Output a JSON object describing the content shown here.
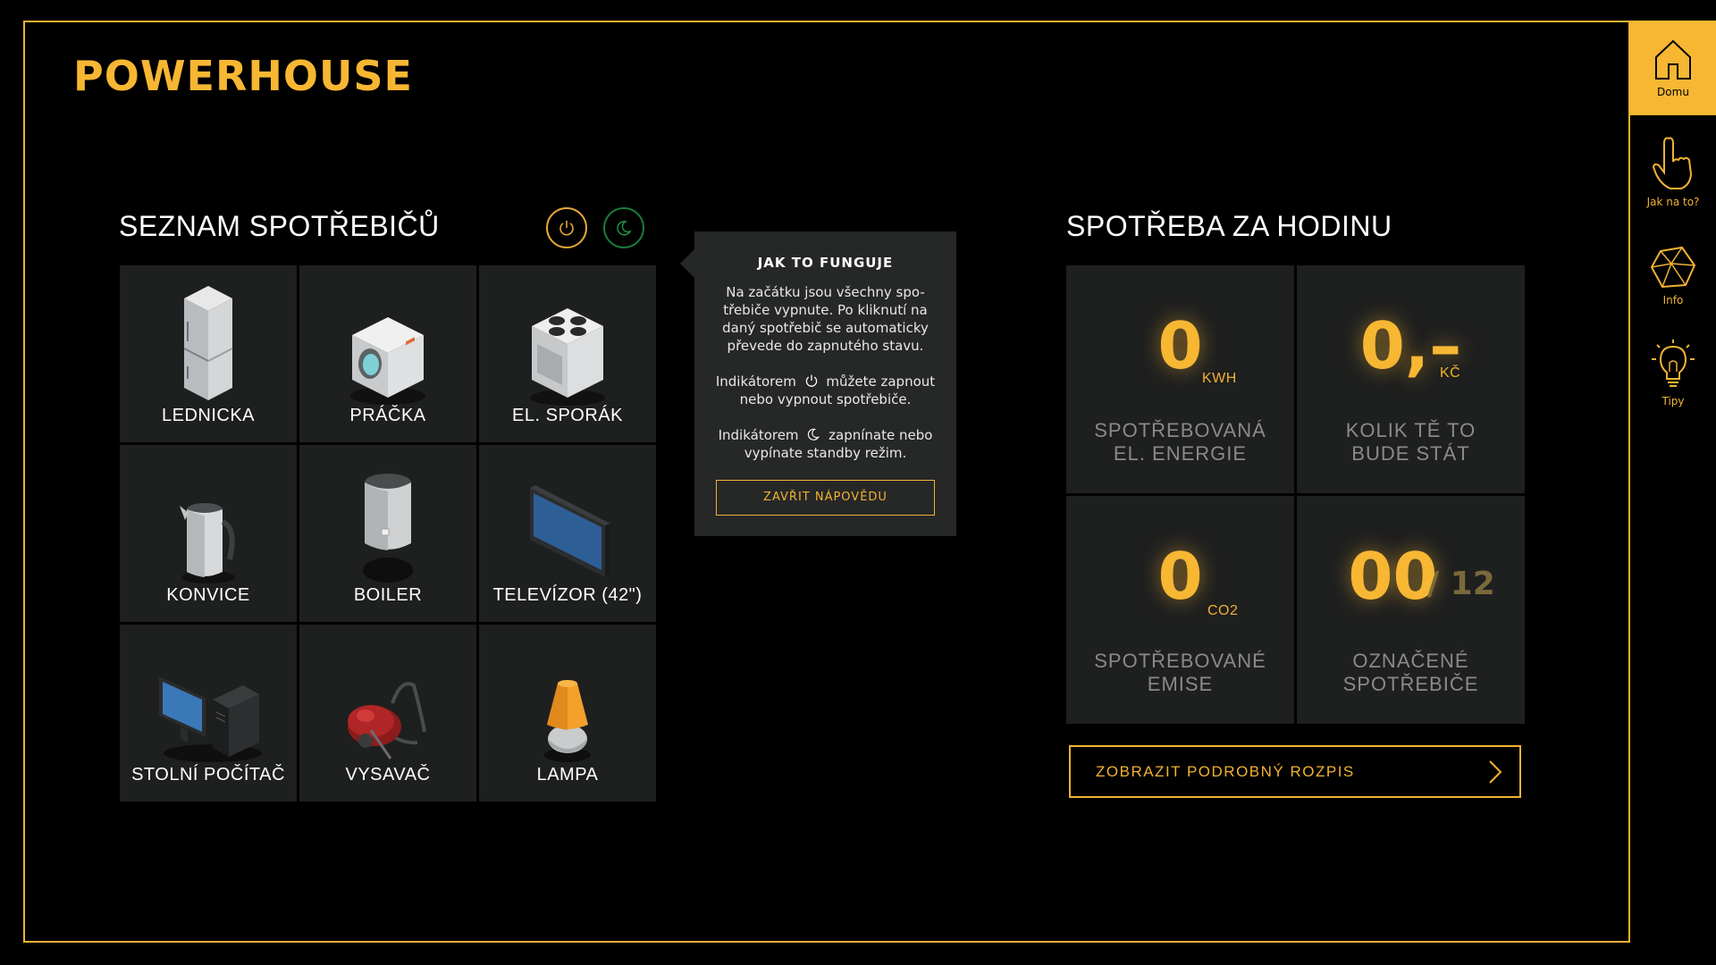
{
  "app": {
    "logo": "POWERHOUSE"
  },
  "appliances": {
    "title": "SEZNAM SPOTŘEBIČŮ",
    "items": [
      {
        "label": "LEDNICKA",
        "icon": "fridge-icon"
      },
      {
        "label": "PRÁČKA",
        "icon": "washing-machine-icon"
      },
      {
        "label": "EL. SPORÁK",
        "icon": "stove-icon"
      },
      {
        "label": "KONVICE",
        "icon": "kettle-icon"
      },
      {
        "label": "BOILER",
        "icon": "boiler-icon"
      },
      {
        "label": "TELEVÍZOR (42\")",
        "icon": "television-icon"
      },
      {
        "label": "STOLNÍ POČÍTAČ",
        "icon": "desktop-computer-icon"
      },
      {
        "label": "VYSAVAČ",
        "icon": "vacuum-cleaner-icon"
      },
      {
        "label": "LAMPA",
        "icon": "lamp-icon"
      }
    ]
  },
  "help": {
    "title": "JAK TO FUNGUJE",
    "p1": "Na začátku jsou všechny spo-třebiče vypnute. Po kliknutí na daný spotřebič se automaticky převede do zapnutého stavu.",
    "p2_before": "Indikátorem",
    "p2_after": "můžete zapnout nebo vypnout spotřebiče.",
    "p3_before": "Indikátorem",
    "p3_after": "zapnínate nebo vypínate standby režim.",
    "close_label": "ZAVŘIT NÁPOVĚDU"
  },
  "usage": {
    "title": "SPOTŘEBA ZA HODINU",
    "energy": {
      "value": "0",
      "unit": "KWH",
      "line1": "SPOTŘEBOVANÁ",
      "line2": "EL. ENERGIE"
    },
    "cost": {
      "value": "0,–",
      "unit": "KČ",
      "line1": "KOLIK TĚ TO",
      "line2": "BUDE STÁT"
    },
    "emissions": {
      "value": "0",
      "unit": "CO2",
      "line1": "SPOTŘEBOVANÉ",
      "line2": "EMISE"
    },
    "marked": {
      "value": "00",
      "total": "/ 12",
      "line1": "OZNAČENÉ",
      "line2": "SPOTŘEBIČE"
    },
    "detail_button": "ZOBRAZIT PODROBNÝ ROZPIS"
  },
  "nav": {
    "home": "Domu",
    "howto": "Jak na to?",
    "info": "Info",
    "tips": "Tipy"
  },
  "colors": {
    "accent": "#f7b733",
    "tile": "#1e1f1f",
    "standby": "#1a7a3a"
  }
}
